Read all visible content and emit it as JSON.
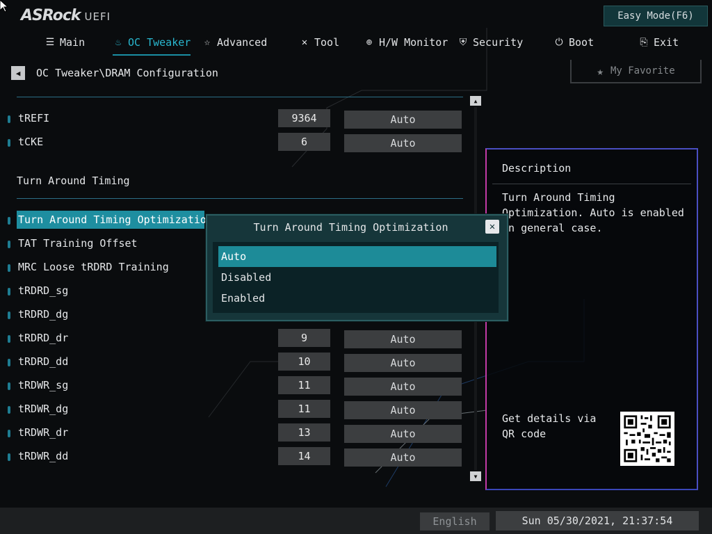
{
  "brand": {
    "name": "ASRock",
    "suffix": "UEFI"
  },
  "easy_mode_label": "Easy Mode(F6)",
  "tabs": [
    {
      "label": "Main",
      "icon": "list-icon"
    },
    {
      "label": "OC Tweaker",
      "icon": "flame-icon",
      "active": true
    },
    {
      "label": "Advanced",
      "icon": "star-icon"
    },
    {
      "label": "Tool",
      "icon": "tools-icon"
    },
    {
      "label": "H/W Monitor",
      "icon": "monitor-icon"
    },
    {
      "label": "Security",
      "icon": "shield-icon"
    },
    {
      "label": "Boot",
      "icon": "power-icon"
    },
    {
      "label": "Exit",
      "icon": "exit-icon"
    }
  ],
  "breadcrumb": "OC Tweaker\\DRAM Configuration",
  "favorite_label": "My Favorite",
  "section_title": "Turn Around Timing",
  "rows": [
    {
      "label": "tREFI",
      "value": "9364",
      "mode": "Auto"
    },
    {
      "label": "tCKE",
      "value": "6",
      "mode": "Auto"
    },
    {
      "label": "Turn Around Timing Optimization",
      "value": "",
      "mode": "",
      "selected": true
    },
    {
      "label": "TAT Training Offset",
      "value": "",
      "mode": ""
    },
    {
      "label": "MRC Loose tRDRD Training",
      "value": "",
      "mode": ""
    },
    {
      "label": "tRDRD_sg",
      "value": "",
      "mode": ""
    },
    {
      "label": "tRDRD_dg",
      "value": "",
      "mode": ""
    },
    {
      "label": "tRDRD_dr",
      "value": "9",
      "mode": "Auto"
    },
    {
      "label": "tRDRD_dd",
      "value": "10",
      "mode": "Auto"
    },
    {
      "label": "tRDWR_sg",
      "value": "11",
      "mode": "Auto"
    },
    {
      "label": "tRDWR_dg",
      "value": "11",
      "mode": "Auto"
    },
    {
      "label": "tRDWR_dr",
      "value": "13",
      "mode": "Auto"
    },
    {
      "label": "tRDWR_dd",
      "value": "14",
      "mode": "Auto"
    }
  ],
  "popup": {
    "title": "Turn Around Timing Optimization",
    "options": [
      "Auto",
      "Disabled",
      "Enabled"
    ],
    "selected": "Auto"
  },
  "description": {
    "title": "Description",
    "text": "Turn Around Timing Optimization. Auto is enabled in general case.",
    "qr_text": "Get details via QR code"
  },
  "footer": {
    "language": "English",
    "datetime": "Sun 05/30/2021, 21:37:54"
  },
  "colors": {
    "accent": "#1e8ea0",
    "active_tab": "#29b7cf",
    "popup_bg": "#16363a",
    "desc_border_left": "#c23aa6",
    "desc_border_right": "#4a4fc2"
  }
}
